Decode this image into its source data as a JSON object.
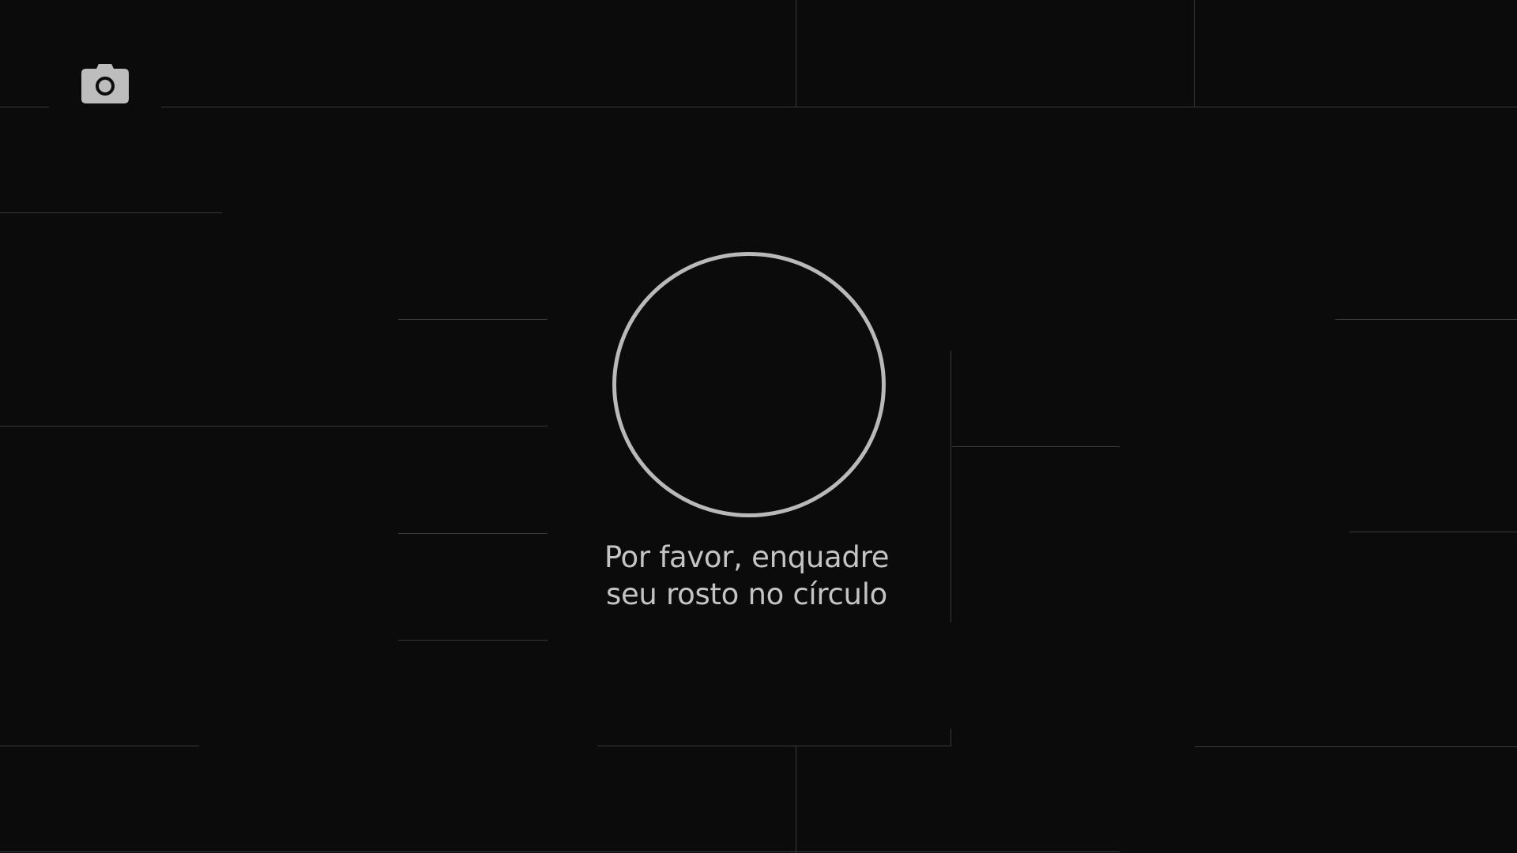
{
  "screen": {
    "background_color": "#0b0b0b",
    "grid_line_color": "#3a3a3a",
    "accent_color": "#b9b9b9"
  },
  "camera_button": {
    "icon": "camera-icon"
  },
  "face_guide": {
    "shape": "circle"
  },
  "instruction": {
    "line1": "Por favor, enquadre",
    "line2": "seu rosto no círculo"
  }
}
